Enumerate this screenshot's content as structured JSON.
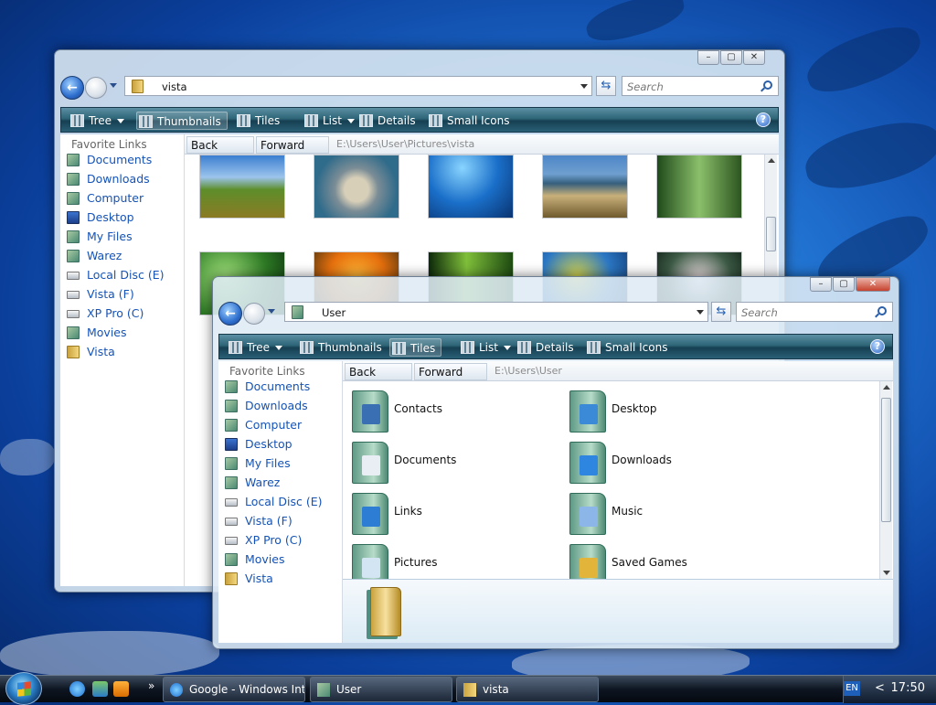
{
  "desktop": {},
  "win1": {
    "address": "vista",
    "search_placeholder": "Search",
    "toolbar": {
      "tree": "Tree",
      "thumbnails": "Thumbnails",
      "tiles": "Tiles",
      "list": "List",
      "details": "Details",
      "small_icons": "Small Icons",
      "help": "?"
    },
    "sidebar_header": "Favorite Links",
    "sidebar": [
      {
        "label": "Documents",
        "icon": "documents-icon"
      },
      {
        "label": "Downloads",
        "icon": "downloads-icon"
      },
      {
        "label": "Computer",
        "icon": "computer-icon"
      },
      {
        "label": "Desktop",
        "icon": "desktop-icon"
      },
      {
        "label": "My Files",
        "icon": "myfiles-icon"
      },
      {
        "label": "Warez",
        "icon": "warez-icon"
      },
      {
        "label": "Local Disc (E)",
        "icon": "drive-icon"
      },
      {
        "label": "Vista (F)",
        "icon": "drive-icon"
      },
      {
        "label": "XP Pro (C)",
        "icon": "drive-icon"
      },
      {
        "label": "Movies",
        "icon": "movies-icon"
      },
      {
        "label": "Vista",
        "icon": "folder-icon"
      }
    ],
    "nav": {
      "back": "Back",
      "forward": "Forward",
      "path": "E:\\Users\\User\\Pictures\\vista"
    }
  },
  "win2": {
    "address": "User",
    "search_placeholder": "Search",
    "toolbar": {
      "tree": "Tree",
      "thumbnails": "Thumbnails",
      "tiles": "Tiles",
      "list": "List",
      "details": "Details",
      "small_icons": "Small Icons",
      "help": "?"
    },
    "sidebar_header": "Favorite Links",
    "sidebar": [
      {
        "label": "Documents",
        "icon": "documents-icon"
      },
      {
        "label": "Downloads",
        "icon": "downloads-icon"
      },
      {
        "label": "Computer",
        "icon": "computer-icon"
      },
      {
        "label": "Desktop",
        "icon": "desktop-icon"
      },
      {
        "label": "My Files",
        "icon": "myfiles-icon"
      },
      {
        "label": "Warez",
        "icon": "warez-icon"
      },
      {
        "label": "Local Disc (E)",
        "icon": "drive-icon"
      },
      {
        "label": "Vista (F)",
        "icon": "drive-icon"
      },
      {
        "label": "XP Pro (C)",
        "icon": "drive-icon"
      },
      {
        "label": "Movies",
        "icon": "movies-icon"
      },
      {
        "label": "Vista",
        "icon": "folder-icon"
      }
    ],
    "nav": {
      "back": "Back",
      "forward": "Forward",
      "path": "E:\\Users\\User"
    },
    "tiles": [
      {
        "label": "Contacts",
        "icon": "contacts-icon"
      },
      {
        "label": "Desktop",
        "icon": "desktop-folder-icon"
      },
      {
        "label": "Documents",
        "icon": "documents-folder-icon"
      },
      {
        "label": "Downloads",
        "icon": "downloads-folder-icon"
      },
      {
        "label": "Links",
        "icon": "links-folder-icon"
      },
      {
        "label": "Music",
        "icon": "music-folder-icon"
      },
      {
        "label": "Pictures",
        "icon": "pictures-folder-icon"
      },
      {
        "label": "Saved Games",
        "icon": "saved-games-folder-icon"
      }
    ]
  },
  "taskbar": {
    "tasks": [
      {
        "label": "Google - Windows Inte...",
        "icon": "ie-icon"
      },
      {
        "label": "User",
        "icon": "explorer-icon"
      },
      {
        "label": "vista",
        "icon": "folder-icon"
      }
    ],
    "quicklaunch_more": "»",
    "lang": "EN",
    "tray_chevron": "<",
    "clock": "17:50"
  },
  "colors": {
    "toolbar": "#2e6577",
    "link": "#1553b6",
    "taskbar": "#0e1622"
  }
}
